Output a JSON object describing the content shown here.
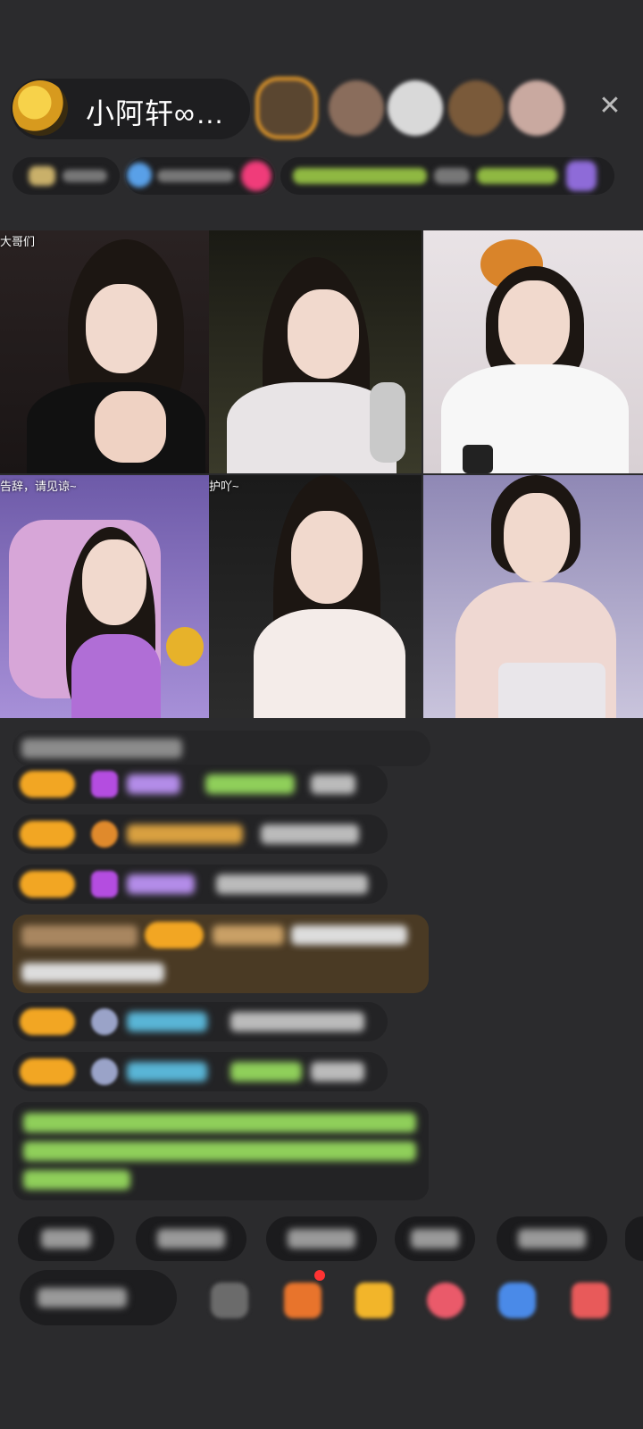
{
  "header": {
    "host_name": "小阿轩∞…",
    "close_icon": "close-icon"
  },
  "tiles": [
    {
      "caption": "大哥们"
    },
    {
      "caption": ""
    },
    {
      "caption": ""
    },
    {
      "caption": "告辞，请见谅~"
    },
    {
      "caption": "护吖~"
    },
    {
      "caption": ""
    }
  ],
  "colors": {
    "background": "#2b2b2d",
    "badge": "#f2a623",
    "viewer_ring": "#e79b2a",
    "green_text": "#8fcf5a"
  }
}
